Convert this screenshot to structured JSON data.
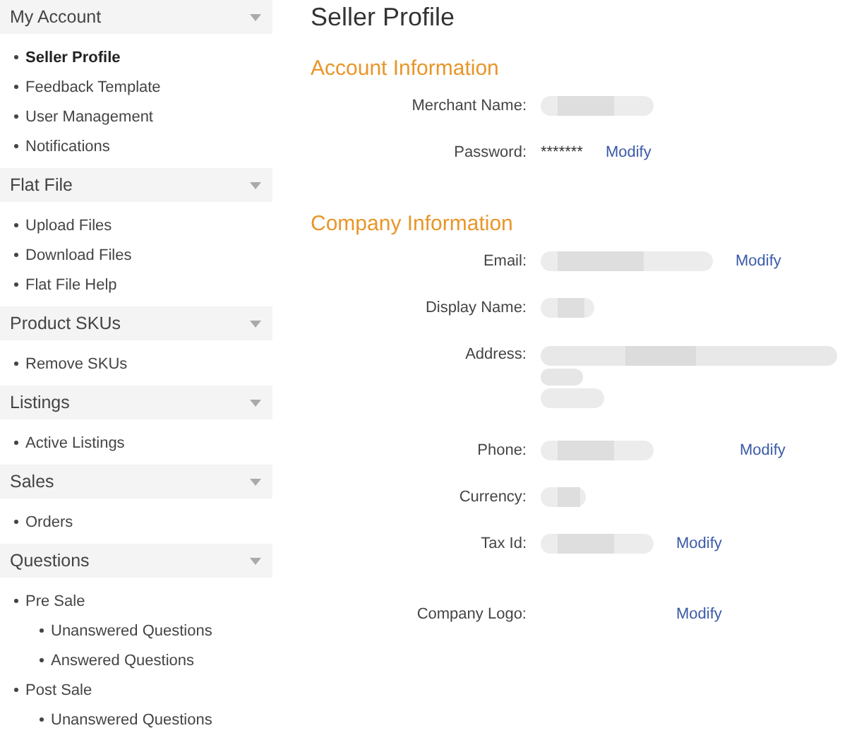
{
  "sidebar": {
    "groups": [
      {
        "title": "My Account",
        "expanded": true,
        "items": [
          {
            "label": "Seller Profile",
            "selected": true
          },
          {
            "label": "Feedback Template",
            "selected": false
          },
          {
            "label": "User Management",
            "selected": false
          },
          {
            "label": "Notifications",
            "selected": false
          }
        ]
      },
      {
        "title": "Flat File",
        "expanded": true,
        "items": [
          {
            "label": "Upload Files",
            "selected": false
          },
          {
            "label": "Download Files",
            "selected": false
          },
          {
            "label": "Flat File Help",
            "selected": false
          }
        ]
      },
      {
        "title": "Product SKUs",
        "expanded": true,
        "items": [
          {
            "label": "Remove SKUs",
            "selected": false
          }
        ]
      },
      {
        "title": "Listings",
        "expanded": true,
        "items": [
          {
            "label": "Active Listings",
            "selected": false
          }
        ]
      },
      {
        "title": "Sales",
        "expanded": true,
        "items": [
          {
            "label": "Orders",
            "selected": false
          }
        ]
      },
      {
        "title": "Questions",
        "expanded": true,
        "items": [
          {
            "label": "Pre Sale",
            "selected": false,
            "children": [
              {
                "label": "Unanswered Questions",
                "selected": false
              },
              {
                "label": "Answered Questions",
                "selected": false
              }
            ]
          },
          {
            "label": "Post Sale",
            "selected": false,
            "children": [
              {
                "label": "Unanswered Questions",
                "selected": false
              }
            ]
          }
        ]
      }
    ]
  },
  "page_title": "Seller Profile",
  "sections": [
    {
      "title": "Account Information",
      "fields": [
        {
          "label": "Merchant Name:",
          "kind": "medium"
        },
        {
          "label": "Password:",
          "value": "*******",
          "action": "Modify"
        }
      ]
    },
    {
      "title": "Company Information",
      "fields": [
        {
          "label": "Email:",
          "kind": "long",
          "action": "Modify"
        },
        {
          "label": "Display Name:",
          "kind": "short"
        },
        {
          "label": "Address:",
          "kind": "multiline"
        },
        {
          "label": "Phone:",
          "kind": "phone",
          "action": "Modify"
        },
        {
          "label": "Currency:",
          "kind": "tiny"
        },
        {
          "label": "Tax Id:",
          "kind": "medium",
          "action": "Modify"
        },
        {
          "label": "Company Logo:",
          "kind": "logo",
          "action": "Modify"
        }
      ]
    }
  ]
}
